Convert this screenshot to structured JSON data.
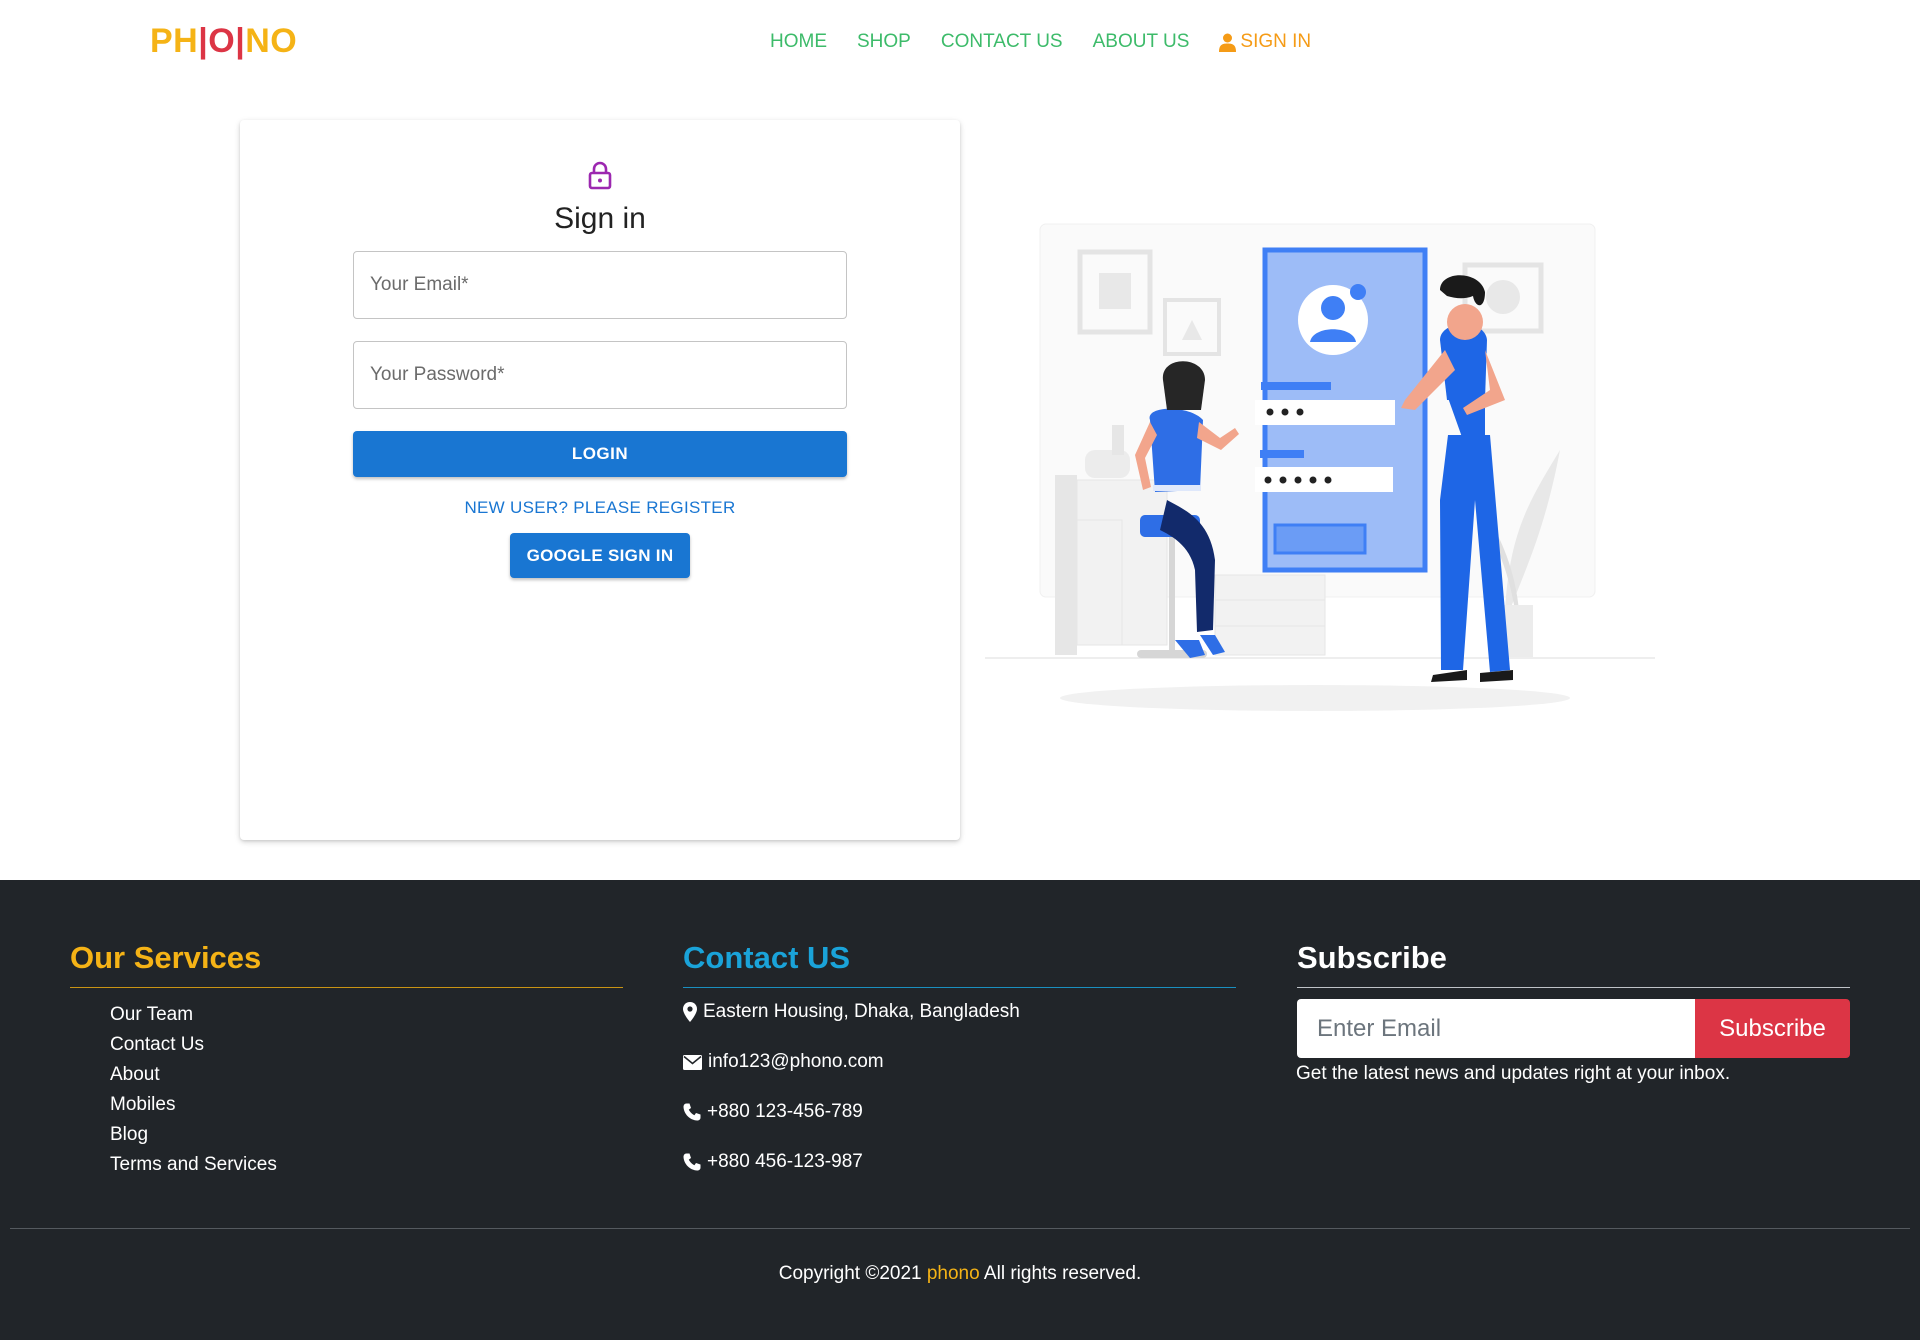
{
  "brand": {
    "logo_parts": [
      "PH",
      "|",
      "O",
      "|",
      "NO"
    ],
    "colors": {
      "yellow": "#f5b316",
      "red": "#dc3545",
      "nav_green": "#3dbb6a",
      "signin_orange": "#f59b16",
      "primary": "#1976d2",
      "footer_bg": "#212529",
      "contact_cyan": "#1aa3d9"
    }
  },
  "nav": {
    "items": [
      "HOME",
      "SHOP",
      "CONTACT US",
      "ABOUT US"
    ],
    "signin_label": "SIGN IN",
    "signin_icon": "user-icon"
  },
  "signin": {
    "icon": "lock-icon",
    "title": "Sign in",
    "email_placeholder": "Your Email*",
    "password_placeholder": "Your Password*",
    "login_label": "LOGIN",
    "register_label": "NEW USER? PLEASE REGISTER",
    "google_label": "GOOGLE SIGN IN"
  },
  "footer": {
    "services": {
      "heading": "Our Services",
      "items": [
        "Our Team",
        "Contact Us",
        "About",
        "Mobiles",
        "Blog",
        "Terms and Services"
      ]
    },
    "contact": {
      "heading": "Contact US",
      "address": "Eastern Housing, Dhaka, Bangladesh",
      "email": "info123@phono.com",
      "phone1": "+880 123-456-789",
      "phone2": "+880 456-123-987"
    },
    "subscribe": {
      "heading": "Subscribe",
      "placeholder": "Enter Email",
      "button": "Subscribe",
      "note": "Get the latest news and updates right at your inbox."
    },
    "copyright": {
      "prefix": "Copyright ©2021 ",
      "brand": "phono",
      "suffix": " All rights reserved."
    }
  }
}
